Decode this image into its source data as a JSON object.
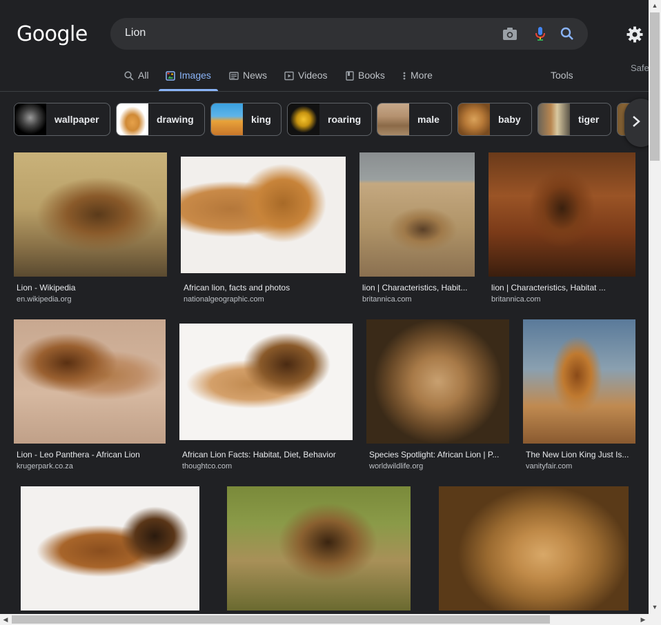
{
  "header": {
    "logo_text": "Google",
    "search_query": "Lion"
  },
  "tabs": [
    {
      "label": "All",
      "icon": "search-icon"
    },
    {
      "label": "Images",
      "icon": "images-icon",
      "active": true
    },
    {
      "label": "News",
      "icon": "news-icon"
    },
    {
      "label": "Videos",
      "icon": "videos-icon"
    },
    {
      "label": "Books",
      "icon": "books-icon"
    },
    {
      "label": "More",
      "icon": "more-icon"
    }
  ],
  "tools_label": "Tools",
  "safe_label": "Safe",
  "chips": [
    "wallpaper",
    "drawing",
    "king",
    "roaring",
    "male",
    "baby",
    "tiger"
  ],
  "results": [
    {
      "title": "Lion - Wikipedia",
      "source": "en.wikipedia.org"
    },
    {
      "title": "African lion, facts and photos",
      "source": "nationalgeographic.com"
    },
    {
      "title": "lion | Characteristics, Habit...",
      "source": "britannica.com"
    },
    {
      "title": "lion | Characteristics, Habitat ...",
      "source": "britannica.com"
    },
    {
      "title": "Lion - Leo Panthera - African Lion",
      "source": "krugerpark.co.za"
    },
    {
      "title": "African Lion Facts: Habitat, Diet, Behavior",
      "source": "thoughtco.com"
    },
    {
      "title": "Species Spotlight: African Lion | P...",
      "source": "worldwildlife.org"
    },
    {
      "title": "The New Lion King Just Is...",
      "source": "vanityfair.com"
    },
    {
      "title": "",
      "source": ""
    },
    {
      "title": "",
      "source": ""
    },
    {
      "title": "",
      "source": ""
    }
  ],
  "colors": {
    "background": "#202124",
    "accent": "#8ab4f8",
    "search_box": "#303134"
  }
}
